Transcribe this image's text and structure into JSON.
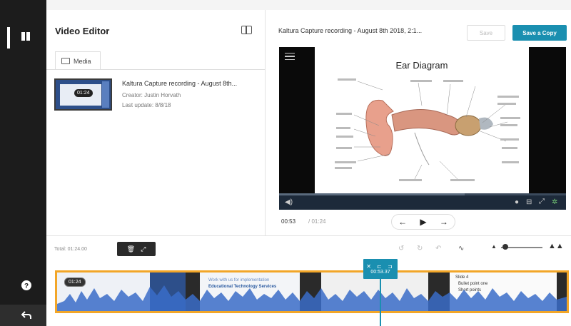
{
  "sidebar": {
    "icons": [
      "panel-icon",
      "help-icon",
      "back-icon"
    ]
  },
  "media_panel": {
    "title": "Video Editor",
    "tab_label": "Media",
    "entry": {
      "duration": "01:24",
      "name": "Kaltura Capture recording - August 8th...",
      "creator": "Creator: Justin Horvath",
      "last_update": "Last update: 8/8/18"
    }
  },
  "player": {
    "title": "Kaltura Capture recording - August 8th 2018, 2:1...",
    "save_label": "Save",
    "save_copy_label": "Save a Copy",
    "slide_title": "Ear Diagram",
    "current_time": "00:53",
    "time_separator": "/",
    "total_time": "01:24"
  },
  "timeline": {
    "total_label": "Total: 01:24.00",
    "cursor_time": "00:53.37",
    "first_clip_duration": "01:24",
    "clip_text_a": "Work with us for implementation",
    "clip_text_b": "Educational Technology Services",
    "clip_text_c": "Slide 4",
    "bullets": [
      "Bullet point one",
      "Short points"
    ]
  },
  "colors": {
    "accent": "#1a8fb0",
    "track_border": "#f2a628",
    "rail": "#1c1c1c"
  }
}
